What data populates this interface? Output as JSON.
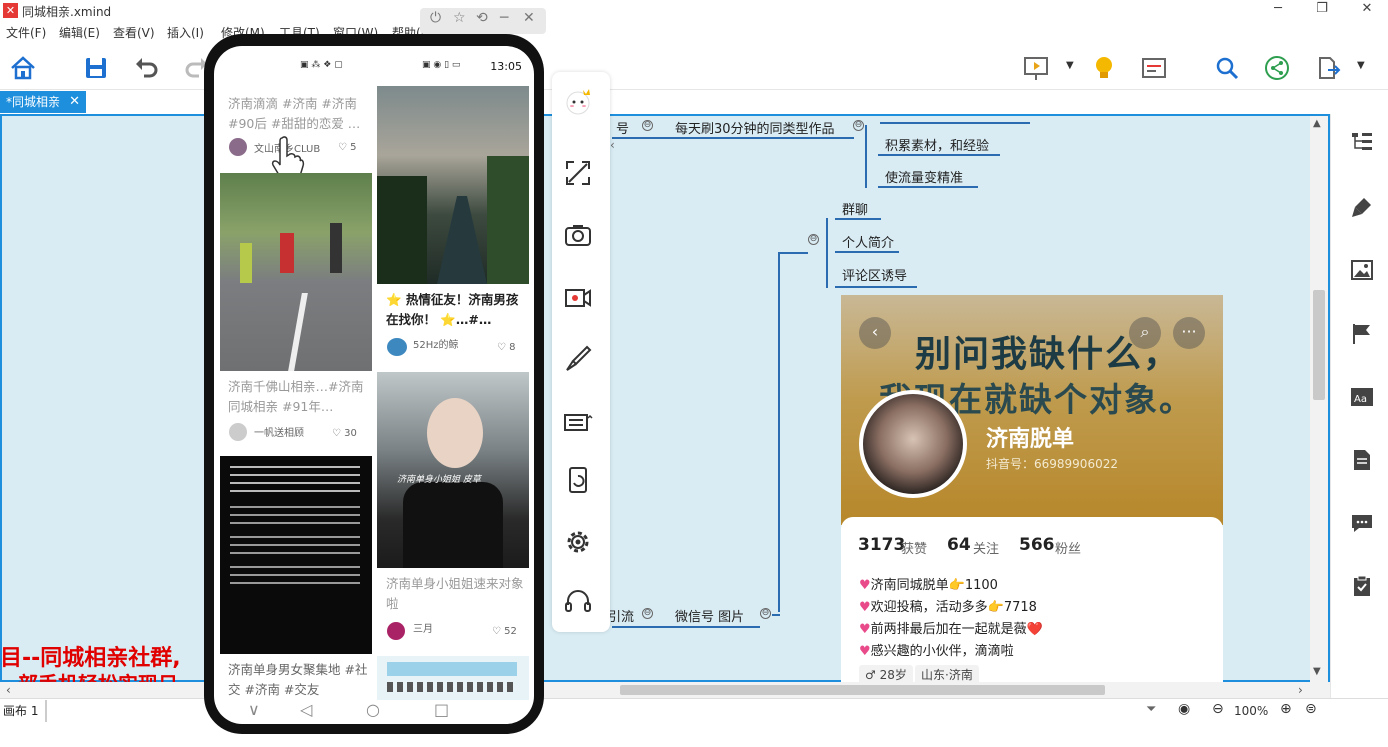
{
  "app": {
    "title": "同城相亲.xmind",
    "logo": "✕"
  },
  "menu": [
    "文件(F)",
    "编辑(E)",
    "查看(V)",
    "插入(I)",
    "修改(M)",
    "工具(T)",
    "窗口(W)",
    "帮助(H)"
  ],
  "window_controls": {
    "minimize": "─",
    "maximize": "❐",
    "close": "✕"
  },
  "tab": {
    "label": "*同城相亲",
    "close": "✕"
  },
  "mindmap": {
    "partial_left_top": "号",
    "branch_1": "每天刷30分钟的同类型作品",
    "branch_1_children": [
      "积累素材，和经验",
      "使流量变精准"
    ],
    "group_children": [
      "群聊",
      "个人简介",
      "评论区诱导"
    ],
    "partial_left_bottom": "引流",
    "branch_2": "微信号 图片",
    "collapse_symbol": "⊖"
  },
  "profile": {
    "banner_line1": "别问我缺什么，",
    "banner_line2": "我现在就缺个对象。",
    "name": "济南脱单",
    "douyin_id": "抖音号：66989906022",
    "stats": [
      {
        "num": "3173",
        "label": "获赞"
      },
      {
        "num": "64",
        "label": "关注"
      },
      {
        "num": "566",
        "label": "粉丝"
      }
    ],
    "bio": [
      "济南同城脱单👉1100",
      "欢迎投稿，活动多多👉7718",
      "前两排最后加在一起就是薇❤️",
      "感兴趣的小伙伴，滴滴啦"
    ],
    "tags": [
      "28岁",
      "山东·济南"
    ],
    "back_btn": "‹",
    "more_btn": "···"
  },
  "left_red": {
    "line1": "目--同城相亲社群,",
    "line2": "部手机轻松实现日"
  },
  "phone": {
    "clock": "13:05",
    "status_left": "▣ ⁂ ❖ ▢",
    "status_right": "▣ ◉ ▯ ▭",
    "cards": [
      {
        "text": "济南滴滴 #济南 #济南 #90后 #甜甜的恋爱 …",
        "author": "文山南乡CLUB",
        "likes": "5"
      },
      {
        "text": "济南千佛山相亲…#济南同城相亲 #91年…",
        "author": "一帆送相顾",
        "likes": "30"
      },
      {
        "text": "济南单身男女聚集地 #社交 #济南 #交友",
        "author": "",
        "likes": ""
      },
      {
        "text": "⭐ 热情征友！济南男孩在找你！ ⭐…#…",
        "author": "52Hz的鲸",
        "likes": "8"
      },
      {
        "text": "济南单身小姐姐速来对象啦",
        "author": "三月",
        "likes": "52"
      }
    ],
    "video_caption": "济南单身小姐姐 皮草",
    "like_symbol": "♡",
    "nav": [
      "∨",
      "◁",
      "○",
      "□"
    ]
  },
  "phone_controls": [
    "⏻",
    "☆",
    "⟲",
    "─",
    "✕"
  ],
  "status_bar": {
    "sheet": "画布 1",
    "zoom": "100%"
  },
  "colors": {
    "accent": "#1d8fdd",
    "canvas_bg": "#d9ecf4",
    "line": "#2b6cb0",
    "red": "#e00000"
  }
}
